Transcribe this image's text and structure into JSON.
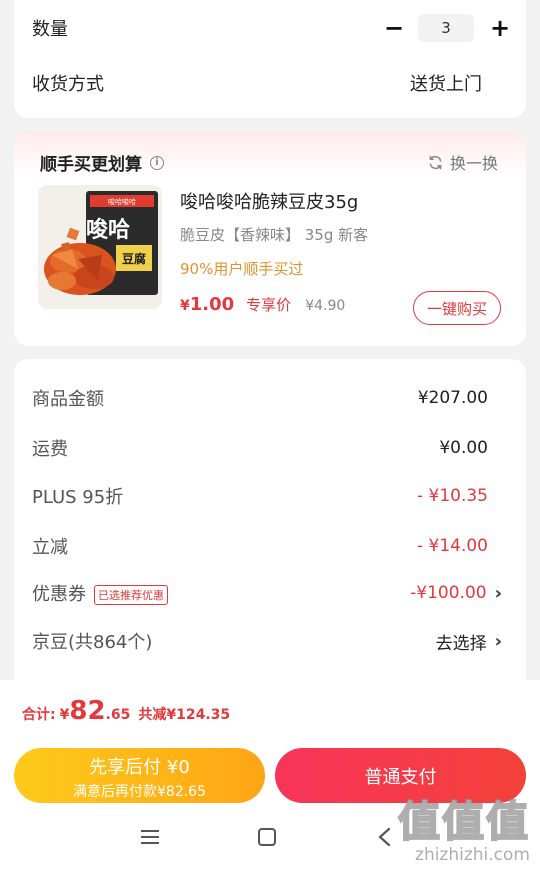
{
  "top": {
    "qty_label": "数量",
    "qty_minus": "−",
    "qty_value": "3",
    "qty_plus": "+",
    "delivery_label": "收货方式",
    "delivery_value": "送货上门"
  },
  "bundle": {
    "title": "顺手买更划算",
    "info_icon_text": "i",
    "refresh_label": "换一换",
    "product": {
      "name": "唆哈唆哈脆辣豆皮35g",
      "spec": "脆豆皮【香辣味】 35g 新客",
      "percent_text": "90%用户顺手买过",
      "price_symbol": "¥",
      "price": "1.00",
      "price_label": "专享价",
      "original_price": "¥4.90",
      "buy_label": "一键购买",
      "package_text_1": "唆哈",
      "package_text_2": "豆腐",
      "package_brand": "唆哈唆哈"
    }
  },
  "summary": {
    "rows": [
      {
        "label": "商品金额",
        "value": "¥207.00"
      },
      {
        "label": "运费",
        "value": "¥0.00"
      },
      {
        "label": "PLUS 95折",
        "value": "- ¥10.35"
      },
      {
        "label": "立减",
        "value": "- ¥14.00"
      },
      {
        "label": "优惠券",
        "tag": "已选推荐优惠",
        "value": "-¥100.00"
      },
      {
        "label": "京豆(共864个)",
        "value": "去选择"
      }
    ]
  },
  "bottom": {
    "total_label": "合计:",
    "total_symbol": "¥",
    "total_int": "82",
    "total_dec": ".65",
    "saved_text": "共减¥124.35",
    "later_line1": "先享后付 ¥0",
    "later_line2": "满意后再付款¥82.65",
    "pay_label": "普通支付"
  },
  "watermark": {
    "big": "值值值",
    "small": "zhizhizhi.com"
  },
  "colors": {
    "accent_red": "#e4393c",
    "orange_text": "#e0922d",
    "pay_later_gradient": [
      "#ffca1b",
      "#ffa514"
    ],
    "pay_gradient": [
      "#f7345a",
      "#f3413a"
    ]
  }
}
